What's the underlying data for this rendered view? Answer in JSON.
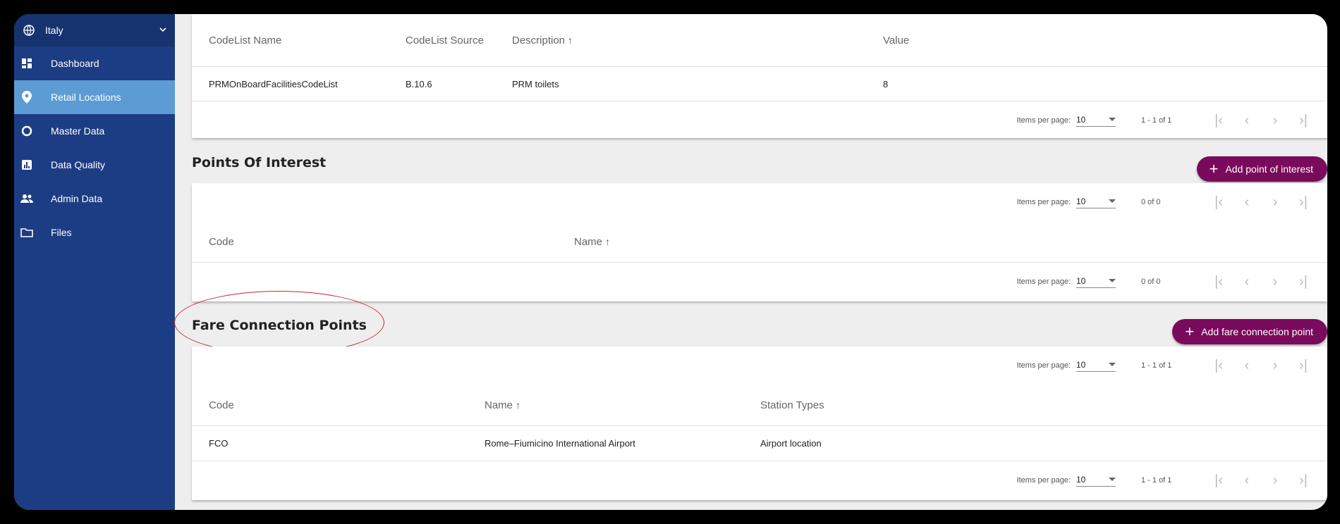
{
  "sidebar": {
    "country": "Italy",
    "items": [
      {
        "label": "Dashboard",
        "icon": "dashboard-icon"
      },
      {
        "label": "Retail Locations",
        "icon": "location-pin-icon"
      },
      {
        "label": "Master Data",
        "icon": "circle-icon"
      },
      {
        "label": "Data Quality",
        "icon": "bar-chart-icon"
      },
      {
        "label": "Admin Data",
        "icon": "people-icon"
      },
      {
        "label": "Files",
        "icon": "folder-icon"
      }
    ]
  },
  "codelist": {
    "headers": {
      "name": "CodeList Name",
      "source": "CodeList Source",
      "description": "Description",
      "value": "Value"
    },
    "row": {
      "name": "PRMOnBoardFacilitiesCodeList",
      "source": "B.10.6",
      "description": "PRM toilets",
      "value": "8"
    },
    "pager": {
      "label": "Items per page:",
      "size": "10",
      "range": "1 - 1 of 1"
    }
  },
  "poi": {
    "title": "Points Of Interest",
    "add_label": "Add point of interest",
    "headers": {
      "code": "Code",
      "name": "Name"
    },
    "pager_top": {
      "label": "Items per page:",
      "size": "10",
      "range": "0 of 0"
    },
    "pager_bottom": {
      "label": "Items per page:",
      "size": "10",
      "range": "0 of 0"
    }
  },
  "fcp": {
    "title": "Fare Connection Points",
    "add_label": "Add fare connection point",
    "headers": {
      "code": "Code",
      "name": "Name",
      "types": "Station Types"
    },
    "row": {
      "code": "FCO",
      "name": "Rome–Fiumicino International Airport",
      "types": "Airport location"
    },
    "pager_top": {
      "label": "Items per page:",
      "size": "10",
      "range": "1 - 1 of 1"
    },
    "pager_bottom": {
      "label": "Items per page:",
      "size": "10",
      "range": "1 - 1 of 1"
    }
  },
  "sort_arrow": "↑",
  "colors": {
    "sidebar": "#1c3d83",
    "active": "#5c9bd4",
    "accent": "#7a0a5c",
    "annotation": "#c62828"
  }
}
